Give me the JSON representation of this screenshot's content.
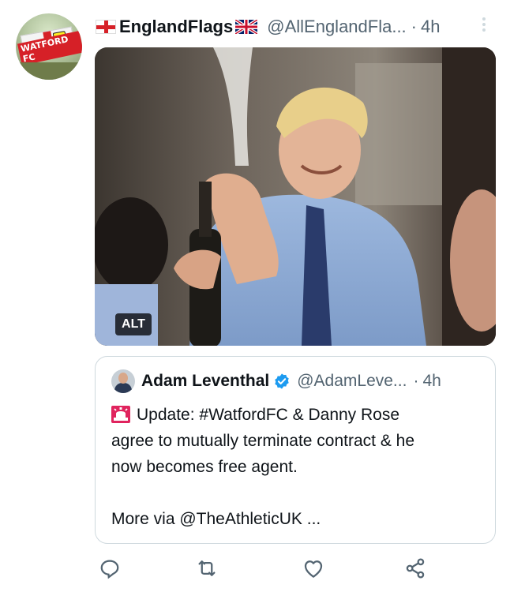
{
  "author": {
    "display_name": "EnglandFlags",
    "handle": "@AllEnglandFla...",
    "separator": "·",
    "time": "4h",
    "avatar_banner_text": "WATFORD FC"
  },
  "media": {
    "alt_badge": "ALT"
  },
  "quoted": {
    "display_name": "Adam Leventhal",
    "handle": "@AdamLeve...",
    "separator": "·",
    "time": "4h",
    "line1": "Update: #WatfordFC & Danny Rose",
    "line2": "agree to mutually terminate contract & he",
    "line3": "now becomes free agent.",
    "line4": "More via @TheAthleticUK ..."
  },
  "actions": [
    {
      "name": "reply",
      "icon": "reply-icon"
    },
    {
      "name": "retweet",
      "icon": "retweet-icon"
    },
    {
      "name": "like",
      "icon": "heart-icon"
    },
    {
      "name": "share",
      "icon": "share-icon"
    }
  ],
  "colors": {
    "text": "#0f1419",
    "secondary": "#536471",
    "border": "#cfd9de",
    "verified": "#1d9bf0",
    "icon": "#536471"
  }
}
